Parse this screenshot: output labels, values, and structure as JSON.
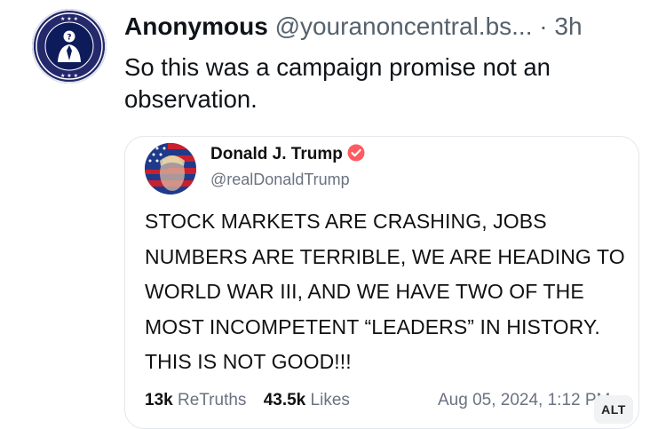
{
  "post": {
    "display_name": "Anonymous",
    "handle": "@youranoncentral.bs...",
    "separator": "·",
    "time": "3h",
    "text": "So this was a campaign promise not an observation."
  },
  "embed": {
    "name": "Donald J. Trump",
    "handle": "@realDonaldTrump",
    "text": "STOCK MARKETS ARE CRASHING, JOBS NUMBERS ARE TERRIBLE, WE ARE HEADING TO WORLD WAR III, AND WE HAVE TWO OF THE MOST INCOMPETENT “LEADERS” IN HISTORY. THIS IS NOT GOOD!!!",
    "retruths_count": "13k",
    "retruths_label": "ReTruths",
    "likes_count": "43.5k",
    "likes_label": "Likes",
    "date": "Aug 05, 2024, 1:12 PM"
  },
  "alt_badge": "ALT",
  "colors": {
    "avatar_bg": "#24296b",
    "verified": "#ff5a5f",
    "text_primary": "#0f1419",
    "text_secondary": "#55616d"
  },
  "icons": [
    "anonymous-logo-icon",
    "trump-avatar-icon",
    "verified-badge-icon"
  ]
}
